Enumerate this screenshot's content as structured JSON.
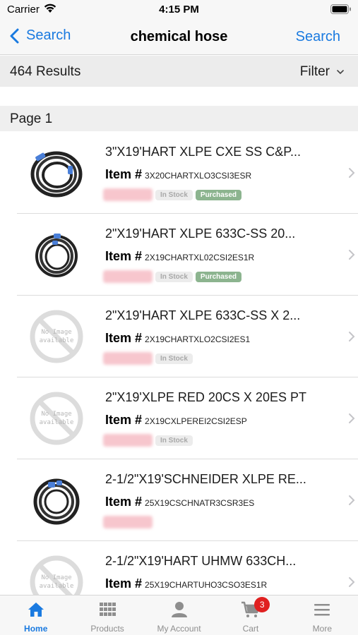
{
  "status_bar": {
    "carrier": "Carrier",
    "time": "4:15 PM"
  },
  "nav": {
    "back_label": "Search",
    "title": "chemical hose",
    "right_label": "Search"
  },
  "results": {
    "count_label": "464 Results",
    "filter_label": "Filter"
  },
  "page_label": "Page 1",
  "item_label": "Item #",
  "products": [
    {
      "title": "3\"X19'HART XLPE CXE SS C&P...",
      "code": "3X20CHARTXLO3CSI3ESR",
      "stock": "In Stock",
      "purchased": "Purchased",
      "image": "hose-image"
    },
    {
      "title": "2\"X19'HART XLPE 633C-SS 20...",
      "code": "2X19CHARTXL02CSI2ES1R",
      "stock": "In Stock",
      "purchased": "Purchased",
      "image": "hose-image"
    },
    {
      "title": "2\"X19'HART XLPE 633C-SS X 2...",
      "code": "2X19CHARTXLO2CSI2ES1",
      "stock": "In Stock",
      "purchased": "",
      "image": "no-image",
      "no_image_text": "No Image available"
    },
    {
      "title": "2\"X19'XLPE RED 20CS X 20ES PT",
      "code": "2X19CXLPEREI2CSI2ESP",
      "stock": "In Stock",
      "purchased": "",
      "image": "no-image",
      "no_image_text": "No Image available"
    },
    {
      "title": "2-1/2\"X19'SCHNEIDER XLPE RE...",
      "code": "25X19CSCHNATR3CSR3ES",
      "stock": "",
      "purchased": "",
      "image": "hose-image"
    },
    {
      "title": "2-1/2\"X19'HART UHMW 633CH...",
      "code": "25X19CHARTUHO3CSO3ES1R",
      "stock": "",
      "purchased": "",
      "image": "no-image",
      "no_image_text": "No Image available"
    }
  ],
  "tabs": [
    {
      "label": "Home",
      "icon": "home-icon",
      "active": true
    },
    {
      "label": "Products",
      "icon": "grid-icon",
      "active": false
    },
    {
      "label": "My Account",
      "icon": "person-icon",
      "active": false
    },
    {
      "label": "Cart",
      "icon": "cart-icon",
      "active": false,
      "badge": "3"
    },
    {
      "label": "More",
      "icon": "menu-icon",
      "active": false
    }
  ],
  "colors": {
    "accent": "#1a7ae0",
    "purchased": "#8cb48f",
    "badge": "#e02020"
  }
}
